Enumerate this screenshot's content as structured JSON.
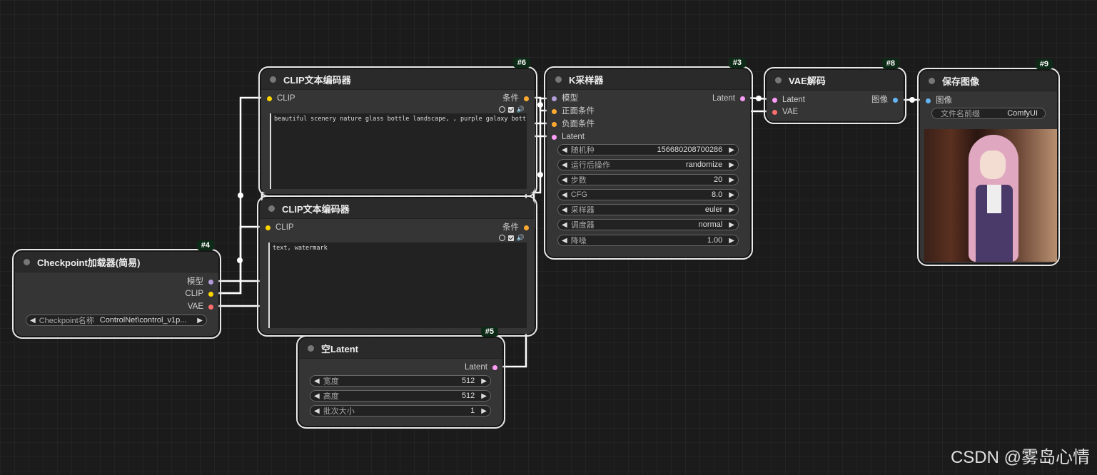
{
  "nodes": {
    "clip1": {
      "id": "#6",
      "title": "CLIP文本编码器",
      "input": "CLIP",
      "output": "条件",
      "text": "beautiful scenery nature glass bottle landscape, , purple galaxy bottle,"
    },
    "clip2": {
      "title": "CLIP文本编码器",
      "input": "CLIP",
      "output": "条件",
      "text": "text, watermark"
    },
    "ksampler": {
      "id": "#3",
      "title": "K采样器",
      "inputs": [
        "模型",
        "正面条件",
        "负面条件",
        "Latent"
      ],
      "output": "Latent",
      "widgets": [
        {
          "label": "随机种",
          "value": "156680208700286"
        },
        {
          "label": "运行后操作",
          "value": "randomize"
        },
        {
          "label": "步数",
          "value": "20"
        },
        {
          "label": "CFG",
          "value": "8.0"
        },
        {
          "label": "采样器",
          "value": "euler"
        },
        {
          "label": "调度器",
          "value": "normal"
        },
        {
          "label": "降噪",
          "value": "1.00"
        }
      ]
    },
    "vae": {
      "id": "#8",
      "title": "VAE解码",
      "inputs": [
        "Latent",
        "VAE"
      ],
      "output": "图像"
    },
    "save": {
      "id": "#9",
      "title": "保存图像",
      "input": "图像",
      "widget_label": "文件名前缀",
      "widget_value": "ComfyUI"
    },
    "checkpoint": {
      "id": "#4",
      "title": "Checkpoint加载器(简易)",
      "outputs": [
        "模型",
        "CLIP",
        "VAE"
      ],
      "widget_label": "Checkpoint名称",
      "widget_value": "ControlNet\\control_v1p..."
    },
    "latent": {
      "id": "#5",
      "title": "空Latent",
      "output": "Latent",
      "widgets": [
        {
          "label": "宽度",
          "value": "512"
        },
        {
          "label": "高度",
          "value": "512"
        },
        {
          "label": "批次大小",
          "value": "1"
        }
      ]
    }
  },
  "colors": {
    "model": "#b39ddb",
    "clip": "#ffd500",
    "vae": "#ff6e6e",
    "conditioning": "#ffa931",
    "latent": "#ff9cf9",
    "image": "#64b5f6",
    "link": "#ffffff"
  },
  "watermark": "CSDN @雾岛心情"
}
